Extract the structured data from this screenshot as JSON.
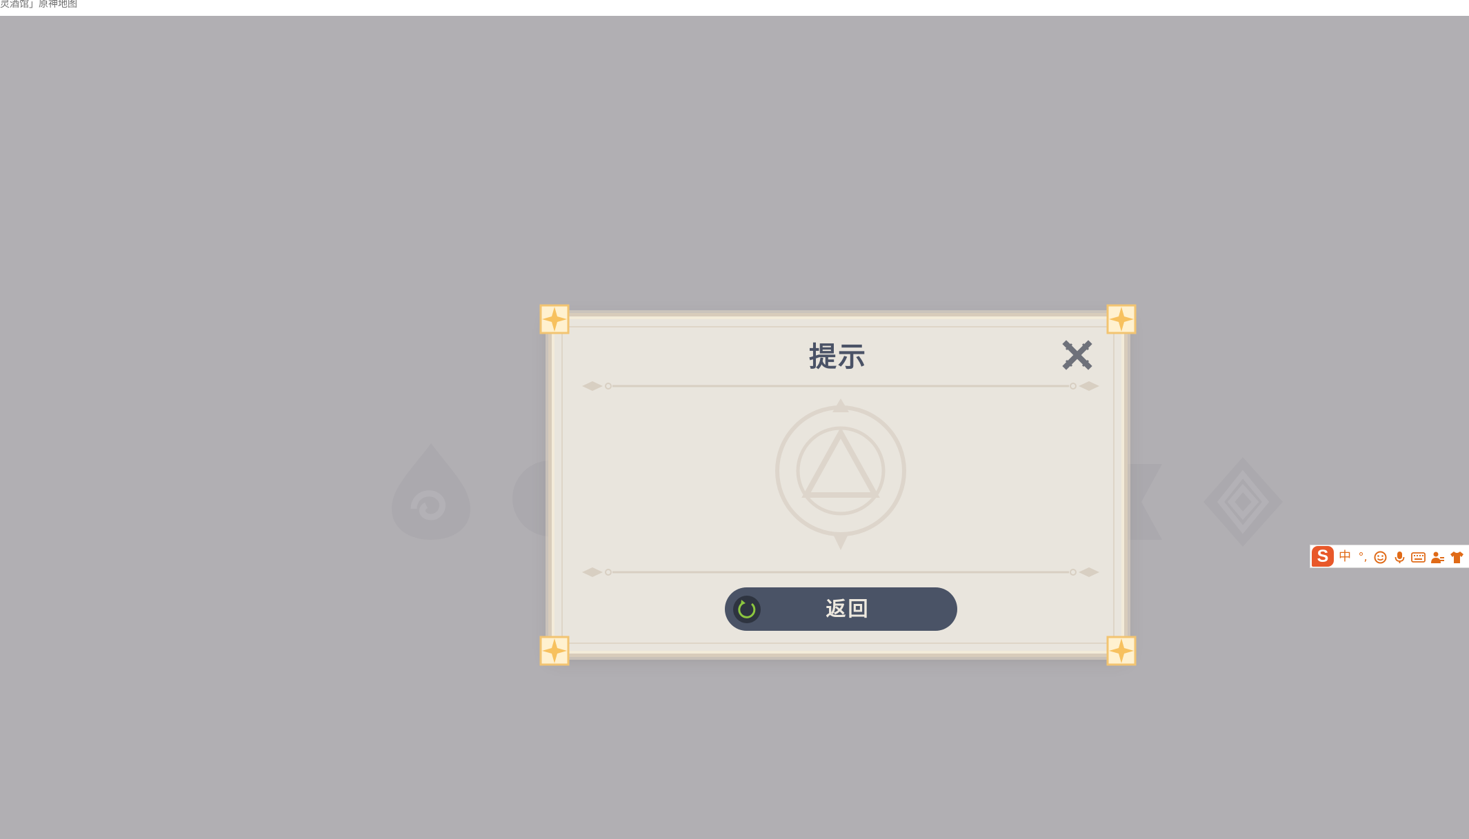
{
  "browser": {
    "title": "灵酒馆」原神地图"
  },
  "dialog": {
    "title": "提示",
    "close_label": "关闭",
    "return_label": "返回"
  },
  "ime_toolbar": {
    "logo_letter": "S",
    "mode_label": "中",
    "punct_label": "°,",
    "accent_color": "#e06a17"
  },
  "colors": {
    "backdrop": "#b1afb3",
    "dialog_bg": "#e9e5dd",
    "button_bg": "#4a5366",
    "title_text": "#4a5266",
    "refresh_icon": "#8cc63f"
  }
}
